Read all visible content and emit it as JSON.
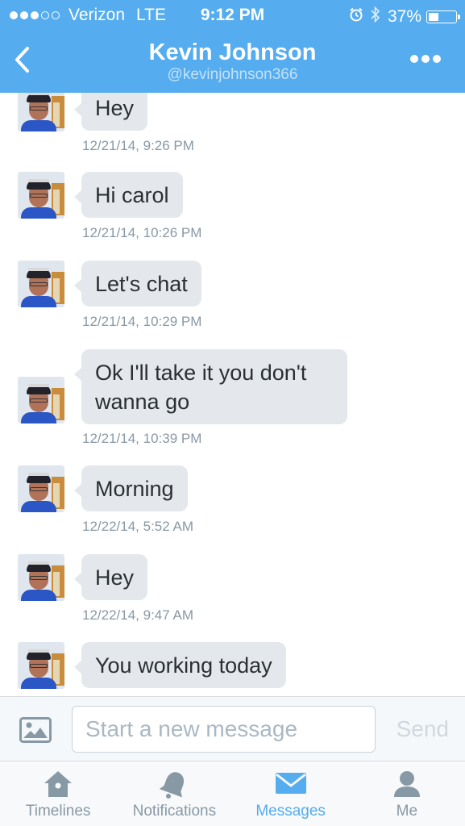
{
  "status_bar": {
    "carrier": "Verizon",
    "network": "LTE",
    "time": "9:12 PM",
    "battery": "37%",
    "battery_level": 0.37,
    "signal_bars": 3,
    "signal_total": 5
  },
  "header": {
    "title": "Kevin Johnson",
    "handle": "@kevinjohnson366",
    "back_icon": "chevron-left-icon",
    "more_icon": "ellipsis-icon"
  },
  "messages": [
    {
      "text": "Hey",
      "timestamp": "12/21/14, 9:26 PM"
    },
    {
      "text": "Hi carol",
      "timestamp": "12/21/14, 10:26 PM"
    },
    {
      "text": "Let's chat",
      "timestamp": "12/21/14, 10:29 PM"
    },
    {
      "text": "Ok I'll take it you don't wanna go",
      "timestamp": "12/21/14, 10:39 PM"
    },
    {
      "text": "Morning",
      "timestamp": "12/22/14, 5:52 AM"
    },
    {
      "text": "Hey",
      "timestamp": "12/22/14, 9:47 AM"
    },
    {
      "text": "You working today",
      "timestamp": ""
    }
  ],
  "composer": {
    "placeholder": "Start a new message",
    "value": "",
    "send_label": "Send",
    "photo_icon": "photo-icon"
  },
  "tabs": [
    {
      "label": "Timelines",
      "icon": "home-icon",
      "active": false
    },
    {
      "label": "Notifications",
      "icon": "bell-icon",
      "active": false
    },
    {
      "label": "Messages",
      "icon": "envelope-icon",
      "active": true
    },
    {
      "label": "Me",
      "icon": "person-icon",
      "active": false
    }
  ],
  "colors": {
    "brand": "#55acee",
    "bubble": "#e4e8ed",
    "timestamp": "#8899a6",
    "tab_inactive": "#8899a6"
  }
}
